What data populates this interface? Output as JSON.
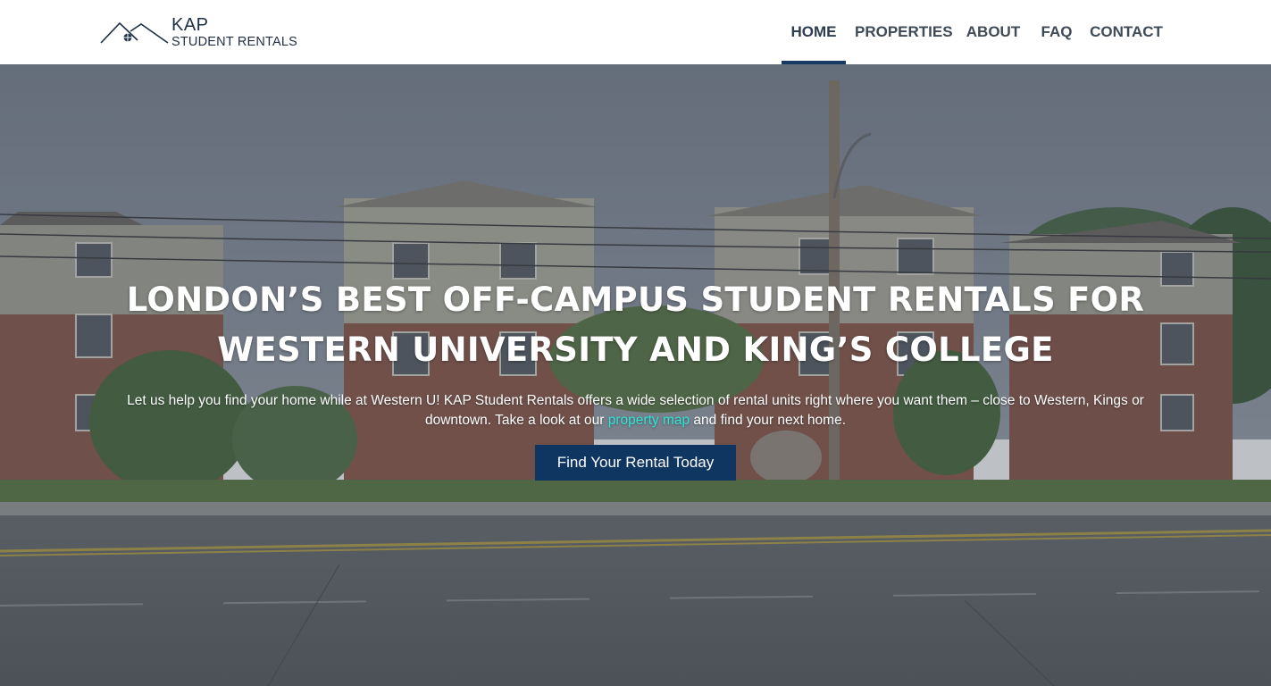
{
  "header": {
    "logo": {
      "top": "KAP",
      "bottom": "STUDENT RENTALS"
    },
    "nav": [
      {
        "label": "HOME",
        "active": true
      },
      {
        "label": "PROPERTIES",
        "active": false
      },
      {
        "label": "ABOUT",
        "active": false
      },
      {
        "label": "FAQ",
        "active": false
      },
      {
        "label": "CONTACT",
        "active": false
      }
    ]
  },
  "hero": {
    "title_line1": "LONDON’S BEST OFF-CAMPUS STUDENT RENTALS FOR",
    "title_line2": "WESTERN UNIVERSITY AND KING’S COLLEGE",
    "desc_before_link": "Let us help you find your home while at Western U! KAP Student Rentals offers a wide selection of rental units right where you want them – close to Western, Kings or downtown. Take a look at our ",
    "link_text": "property map",
    "desc_after_link": " and find your next home.",
    "cta_label": "Find Your Rental Today",
    "background_icon": "street-apartments-photo"
  },
  "colors": {
    "nav_text": "#3f4a57",
    "nav_active_underline": "#163a63",
    "cta_background": "#0f3561",
    "link": "#2ee6d6",
    "logo_text": "#1f2f45"
  }
}
